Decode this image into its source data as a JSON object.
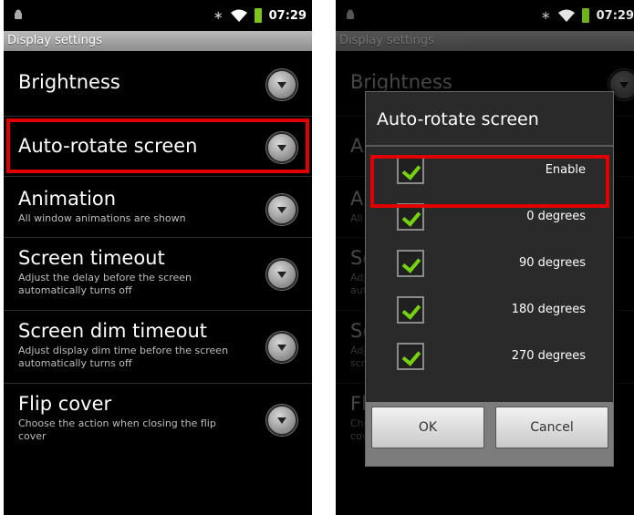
{
  "status": {
    "time": "07:29"
  },
  "left": {
    "title": "Display settings",
    "items": [
      {
        "title": "Brightness",
        "subtitle": ""
      },
      {
        "title": "Auto-rotate screen",
        "subtitle": ""
      },
      {
        "title": "Animation",
        "subtitle": "All window animations are shown"
      },
      {
        "title": "Screen timeout",
        "subtitle": "Adjust the delay before the screen automatically turns off"
      },
      {
        "title": "Screen dim timeout",
        "subtitle": "Adjust display dim time before the screen automatically turns off"
      },
      {
        "title": "Flip cover",
        "subtitle": "Choose the action when closing the flip cover"
      }
    ]
  },
  "dialog": {
    "title": "Auto-rotate screen",
    "options": [
      {
        "label": "Enable",
        "checked": true
      },
      {
        "label": "0 degrees",
        "checked": true
      },
      {
        "label": "90 degrees",
        "checked": true
      },
      {
        "label": "180 degrees",
        "checked": true
      },
      {
        "label": "270 degrees",
        "checked": true
      }
    ],
    "ok": "OK",
    "cancel": "Cancel"
  },
  "colors": {
    "highlight": "#e00000",
    "check": "#76d10f",
    "battery": "#7cc61c"
  }
}
